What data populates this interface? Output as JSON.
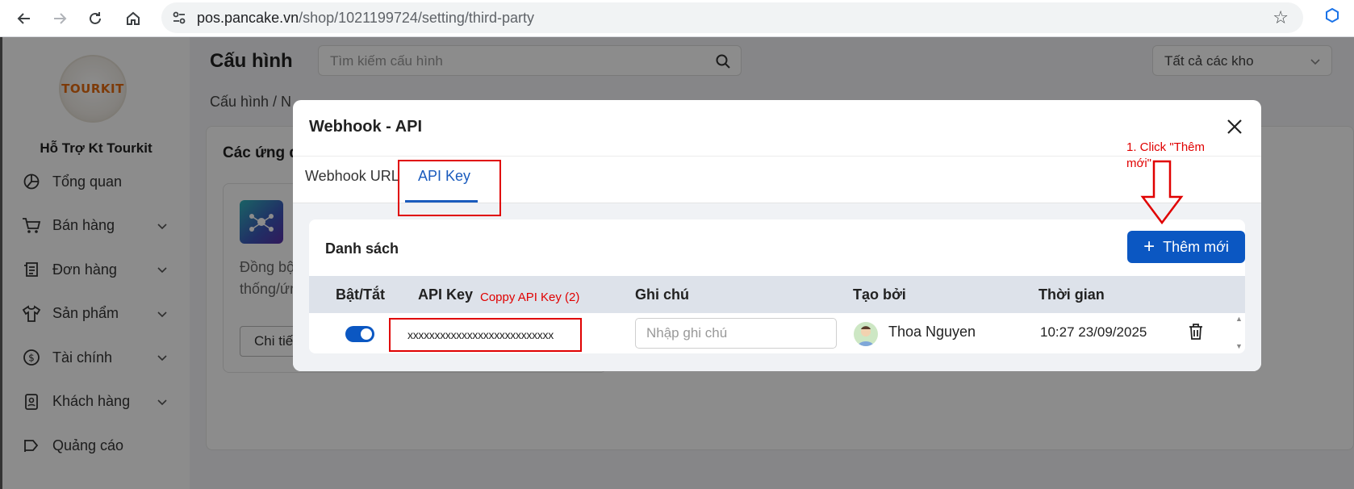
{
  "browser": {
    "url_host": "pos.pancake.vn",
    "url_path": "/shop/1021199724/setting/third-party",
    "icons": [
      "back-icon",
      "forward-icon",
      "reload-icon",
      "home-icon",
      "site-info-icon",
      "bookmark-star-icon",
      "extension-icon"
    ]
  },
  "sidebar": {
    "logo_text": "TOURKIT",
    "shop_name": "Hỗ Trợ Kt Tourkit",
    "items": [
      {
        "label": "Tổng quan",
        "icon": "pie-chart-icon",
        "expandable": false
      },
      {
        "label": "Bán hàng",
        "icon": "cart-icon",
        "expandable": true
      },
      {
        "label": "Đơn hàng",
        "icon": "receipt-icon",
        "expandable": true
      },
      {
        "label": "Sản phẩm",
        "icon": "shirt-icon",
        "expandable": true
      },
      {
        "label": "Tài chính",
        "icon": "dollar-icon",
        "expandable": true
      },
      {
        "label": "Khách hàng",
        "icon": "contact-icon",
        "expandable": true
      },
      {
        "label": "Quảng cáo",
        "icon": "megaphone-icon",
        "expandable": false
      }
    ]
  },
  "header": {
    "title": "Cấu hình",
    "search_placeholder": "Tìm kiếm cấu hình",
    "store_select": "Tất cả các kho"
  },
  "breadcrumb": "Cấu hình  /  N",
  "content": {
    "section_title": "Các ứng d",
    "app_desc_line1": "Đồng bộ",
    "app_desc_line2": "thống/ứn",
    "detail_button": "Chi tiế"
  },
  "modal": {
    "title": "Webhook - API",
    "tabs": [
      {
        "label": "Webhook URL",
        "active": false
      },
      {
        "label": "API Key",
        "active": true
      }
    ],
    "list_title": "Danh sách",
    "add_button": "Thêm mới",
    "columns": [
      "Bật/Tắt",
      "API Key",
      "Ghi chú",
      "Tạo bởi",
      "Thời gian"
    ],
    "rows": [
      {
        "enabled": true,
        "api_key": "xxxxxxxxxxxxxxxxxxxxxxxxxxx",
        "note_placeholder": "Nhập ghi chú",
        "created_by": "Thoa Nguyen",
        "time": "10:27 23/09/2025"
      }
    ]
  },
  "annotations": {
    "step1_line1": "1. Click \"Thêm",
    "step1_line2": "mới\"",
    "step2": "Coppy API Key (2)",
    "color": "#e00000"
  },
  "colors": {
    "primary": "#0b57c2",
    "annotation": "#e00000"
  }
}
